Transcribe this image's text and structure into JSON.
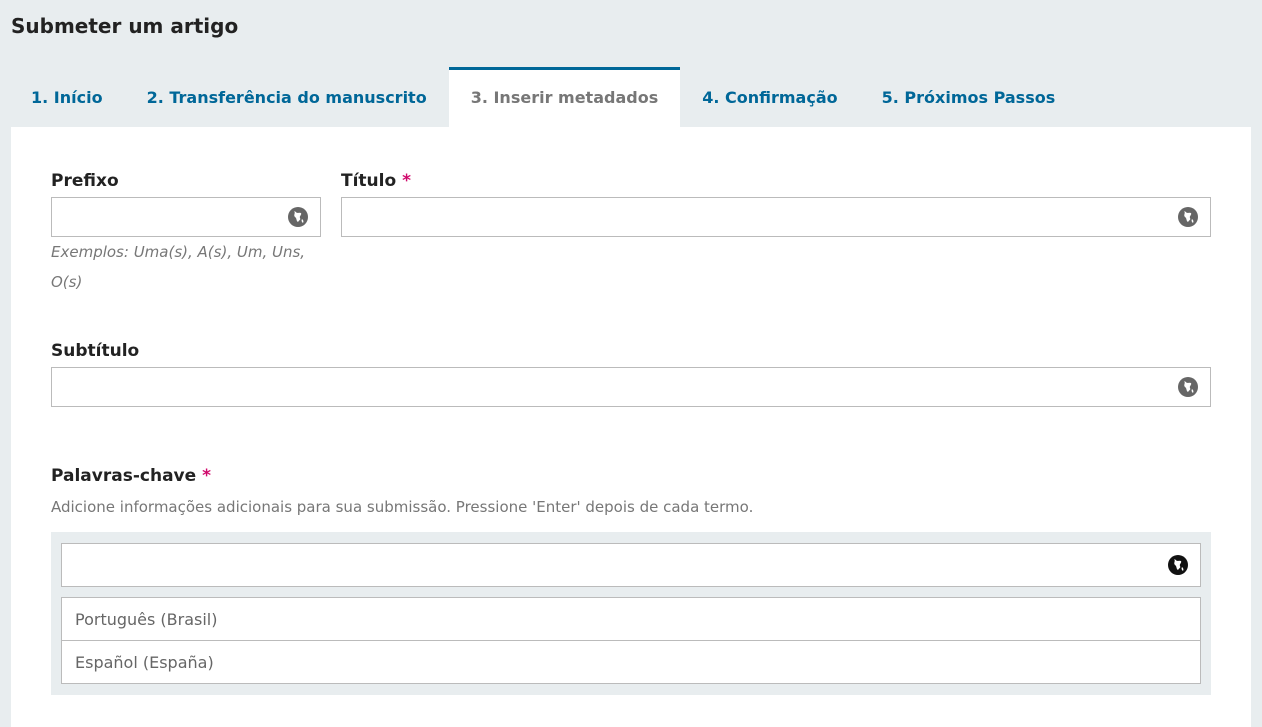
{
  "header": {
    "title": "Submeter um artigo"
  },
  "tabs": [
    {
      "label": "1. Início"
    },
    {
      "label": "2. Transferência do manuscrito"
    },
    {
      "label": "3. Inserir metadados"
    },
    {
      "label": "4. Confirmação"
    },
    {
      "label": "5. Próximos Passos"
    }
  ],
  "active_tab": "3. Inserir metadados",
  "form": {
    "prefix": {
      "label": "Prefixo",
      "value": "",
      "hint": "Exemplos: Uma(s), A(s), Um, Uns, O(s)"
    },
    "title": {
      "label": "Título",
      "required": "*",
      "value": ""
    },
    "subtitle": {
      "label": "Subtítulo",
      "value": ""
    },
    "keywords": {
      "label": "Palavras-chave",
      "required": "*",
      "description": "Adicione informações adicionais para sua submissão. Pressione 'Enter' depois de cada termo.",
      "value": "",
      "languages": [
        "Português (Brasil)",
        "Español (España)"
      ]
    }
  },
  "icons": {
    "locale": "globe-icon"
  },
  "colors": {
    "link": "#006798",
    "required": "#d00a6c",
    "background": "#e8edef"
  }
}
